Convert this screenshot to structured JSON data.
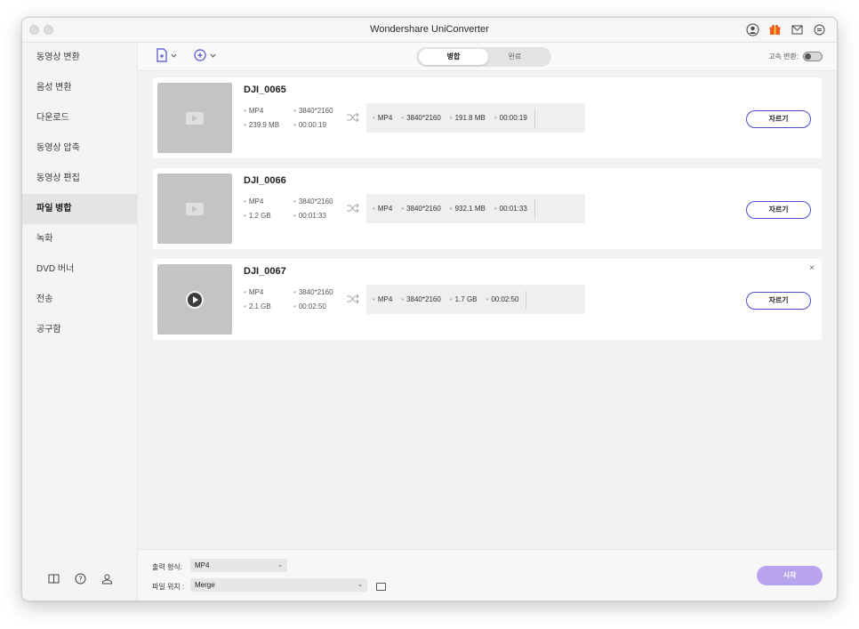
{
  "app": {
    "title": "Wondershare UniConverter"
  },
  "sidebar": {
    "items": [
      {
        "label": "동영상 변환"
      },
      {
        "label": "음성 변환"
      },
      {
        "label": "다운로드"
      },
      {
        "label": "동영상 압축"
      },
      {
        "label": "동영상 편집"
      },
      {
        "label": "파일 병합",
        "active": true
      },
      {
        "label": "녹화"
      },
      {
        "label": "DVD 버너"
      },
      {
        "label": "전송"
      },
      {
        "label": "공구함"
      }
    ],
    "bottom_icons": [
      "book-icon",
      "help-icon",
      "account-icon"
    ]
  },
  "toolbar": {
    "tabs": [
      {
        "label": "병합",
        "active": true
      },
      {
        "label": "완료",
        "active": false
      }
    ],
    "speed_label": "고속 변환:",
    "speed_enabled": false
  },
  "files": [
    {
      "name": "DJI_0065",
      "src_format": "MP4",
      "src_res": "3840*2160",
      "src_size": "239.9 MB",
      "src_duration": "00:00:19",
      "out_format": "MP4",
      "out_res": "3840*2160",
      "out_size": "191.8 MB",
      "out_duration": "00:00:19",
      "trim_label": "자르기",
      "thumb_icon": "video-thumbnail-icon"
    },
    {
      "name": "DJI_0066",
      "src_format": "MP4",
      "src_res": "3840*2160",
      "src_size": "1.2 GB",
      "src_duration": "00:01:33",
      "out_format": "MP4",
      "out_res": "3840*2160",
      "out_size": "932.1 MB",
      "out_duration": "00:01:33",
      "trim_label": "자르기",
      "thumb_icon": "video-thumbnail-icon"
    },
    {
      "name": "DJI_0067",
      "src_format": "MP4",
      "src_res": "3840*2160",
      "src_size": "2.1 GB",
      "src_duration": "00:02:50",
      "out_format": "MP4",
      "out_res": "3840*2160",
      "out_size": "1.7 GB",
      "out_duration": "00:02:50",
      "trim_label": "자르기",
      "thumb_icon": "play-icon",
      "close": "×"
    }
  ],
  "bottom": {
    "format_label": "출력 형식:",
    "format_value": "MP4",
    "location_label": "파일 위치 :",
    "location_value": "Merge",
    "start_label": "시작"
  },
  "colors": {
    "accent": "#4c4cc8",
    "start_button": "#b8a3ef"
  }
}
